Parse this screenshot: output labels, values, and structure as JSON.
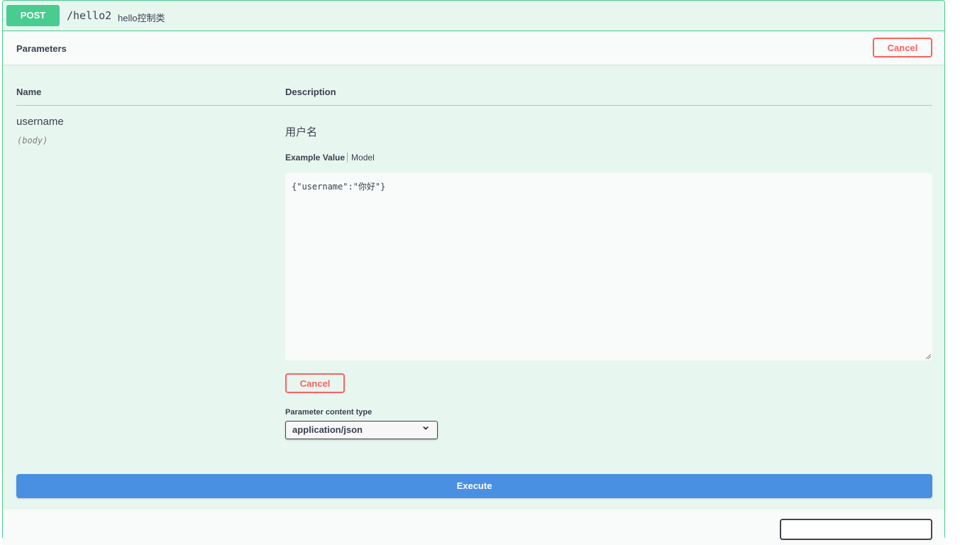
{
  "operation": {
    "method": "POST",
    "path": "/hello2",
    "summary": "hello控制类"
  },
  "parameters_section": {
    "title": "Parameters",
    "cancel_label": "Cancel"
  },
  "table": {
    "name_header": "Name",
    "description_header": "Description"
  },
  "parameter": {
    "name": "username",
    "in": "(body)",
    "description": "用户名",
    "tabs": [
      "Example Value",
      "Model"
    ],
    "body_value": "{\"username\":\"你好\"}",
    "cancel_label": "Cancel",
    "content_type_label": "Parameter content type",
    "content_type_selected": "application/json"
  },
  "execute_label": "Execute",
  "colors": {
    "post_green": "#49cc90",
    "cancel_red": "#ff6060",
    "execute_blue": "#4990e2",
    "panel_bg": "#e8f6f0"
  }
}
